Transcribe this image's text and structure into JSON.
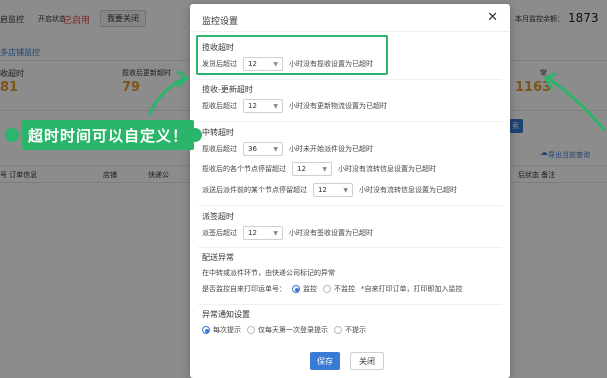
{
  "background": {
    "monitor_label": "启监控",
    "status_label": "开启状态：",
    "status_value": "已启用",
    "close_button": "我要关闭",
    "monthly_label": "本月监控余额：",
    "monthly_value": "1873",
    "multi_store_link": "多店铺监控",
    "stat_receive_label": "收超时",
    "stat_receive_value": "81",
    "stat_update_label": "揽收后更新超时",
    "stat_update_value": "79",
    "stat_other_label": "常",
    "stat_other_value": "1163",
    "search_button": "索",
    "export_link": "导出当前查询",
    "col_order": "号 订单信息",
    "col_store": "店铺",
    "col_express": "快递公",
    "col_status": "后状态 备注",
    "colors": {
      "red": "#e24a4a",
      "orange": "#e89a2c",
      "blue": "#3a7bd5",
      "green": "#2bb56a"
    }
  },
  "modal": {
    "title": "监控设置",
    "close_icon": "close-icon",
    "sections": {
      "receive_timeout": {
        "title": "揽收超时",
        "prefix": "发货后超过",
        "value": "12",
        "suffix": "小时没有揽收设置为已超时"
      },
      "update_timeout": {
        "title": "揽收-更新超时",
        "prefix": "揽收后超过",
        "value": "12",
        "suffix": "小时没有更新物流设置为已超时"
      },
      "transit_timeout": {
        "title": "中转超时",
        "row1_prefix": "揽收后超过",
        "row1_value": "36",
        "row1_suffix": "小时未开始派件设为已超时",
        "row2_prefix": "揽收后的各个节点停留超过",
        "row2_value": "12",
        "row2_suffix": "小时没有流转信息设置为已超时",
        "row3_prefix": "派送后派件前的某个节点停留超过",
        "row3_value": "12",
        "row3_suffix": "小时没有流转信息设置为已超时"
      },
      "delivery_timeout": {
        "title": "派签超时",
        "prefix": "派签后超过",
        "value": "12",
        "suffix": "小时没有签收设置为已超时"
      },
      "dispatch_exception": {
        "title": "配送异常",
        "desc": "在中转或派件环节，由快递公司标记的异常",
        "question": "是否监控自来打印运单号：",
        "opt_yes": "监控",
        "opt_no": "不监控",
        "note": "*自来打印订单，打印即加入监控"
      },
      "notify": {
        "title": "异常通知设置",
        "opt1": "每次提示",
        "opt2": "仅每天第一次登录提示",
        "opt3": "不提示"
      }
    },
    "save_button": "保存",
    "close_button": "关闭"
  },
  "callout": {
    "text": "超时时间可以自定义！"
  }
}
